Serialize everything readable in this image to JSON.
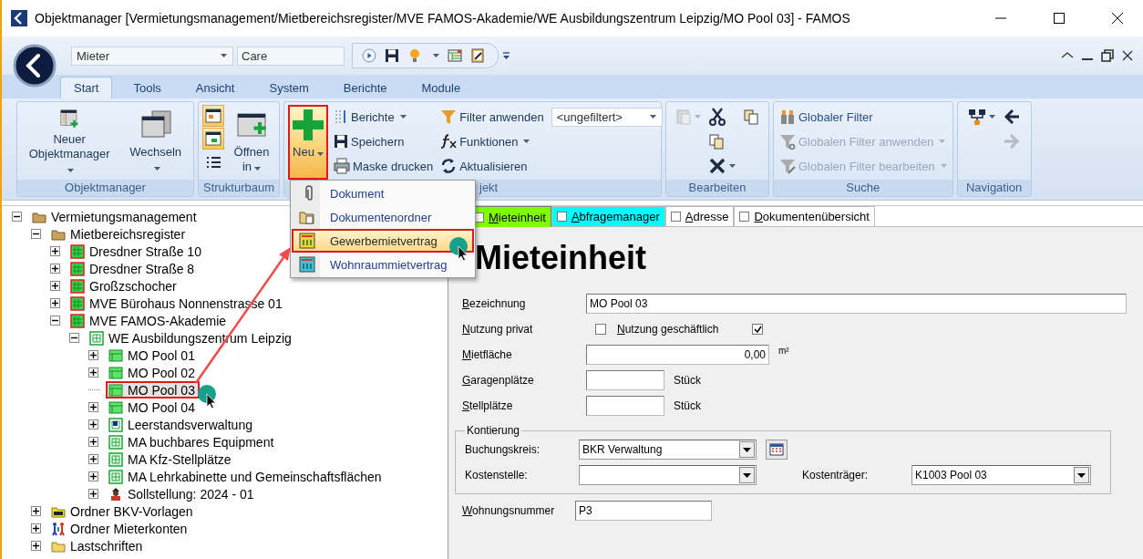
{
  "window": {
    "title": "Objektmanager [Vermietungsmanagement/Mietbereichsregister/MVE FAMOS-Akademie/WE Ausbildungszentrum Leipzig/MO Pool 03] - FAMOS"
  },
  "quick_access": {
    "object_type": "Mieter",
    "search_value": "Care"
  },
  "ribbon_tabs": [
    {
      "label": "Start",
      "selected": true
    },
    {
      "label": "Tools",
      "selected": false
    },
    {
      "label": "Ansicht",
      "selected": false
    },
    {
      "label": "System",
      "selected": false
    },
    {
      "label": "Berichte",
      "selected": false
    },
    {
      "label": "Module",
      "selected": false
    }
  ],
  "ribbon_groups": [
    {
      "title": "Objektmanager",
      "columns": [
        [
          {
            "kind": "large",
            "label": "Neuer Objektmanager",
            "dropdown": true
          }
        ],
        [
          {
            "kind": "large",
            "label": "Wechseln",
            "dropdown": true
          }
        ]
      ]
    },
    {
      "title": "Strukturbaum",
      "columns": [
        [
          {
            "kind": "toggle",
            "on": true
          },
          {
            "kind": "toggle",
            "on": true
          },
          {
            "kind": "icon",
            "disabled": false
          }
        ],
        [
          {
            "kind": "large",
            "label": "Öffnen in",
            "dropdown": true
          }
        ]
      ]
    },
    {
      "title": "jekt",
      "columns": [
        [
          {
            "kind": "large",
            "label": "Neu",
            "dropdown": true,
            "pressed": true,
            "callout": true
          }
        ],
        [
          {
            "kind": "small",
            "label": "Berichte",
            "dropdown": true
          },
          {
            "kind": "small",
            "label": "Speichern"
          },
          {
            "kind": "small",
            "label": "Maske drucken"
          }
        ],
        [
          {
            "kind": "filter",
            "label": "Filter anwenden",
            "value": "<ungefiltert>"
          },
          {
            "kind": "small",
            "label": "Funktionen",
            "dropdown": true
          },
          {
            "kind": "small",
            "label": "Aktualisieren"
          }
        ]
      ]
    },
    {
      "title": "Bearbeiten",
      "columns": [
        [
          {
            "kind": "icon",
            "dropdown": true,
            "disabled": true
          }
        ],
        [
          {
            "kind": "icon",
            "disabled": false
          },
          {
            "kind": "icon",
            "disabled": false
          },
          {
            "kind": "icon",
            "dropdown": true,
            "disabled": false
          }
        ],
        [
          {
            "kind": "icon",
            "disabled": false
          }
        ]
      ]
    },
    {
      "title": "Suche",
      "columns": [
        [
          {
            "kind": "small",
            "label": "Globaler Filter",
            "disabled": false
          },
          {
            "kind": "small",
            "label": "Globalen Filter anwenden",
            "dropdown": true,
            "disabled": true
          },
          {
            "kind": "small",
            "label": "Globalen Filter bearbeiten",
            "dropdown": true,
            "disabled": true
          }
        ]
      ]
    },
    {
      "title": "Navigation",
      "columns": [
        [
          {
            "kind": "icon",
            "dropdown": true,
            "disabled": false
          }
        ],
        [
          {
            "kind": "icon",
            "disabled": false
          },
          {
            "kind": "icon",
            "disabled": true
          }
        ]
      ]
    }
  ],
  "new_menu": {
    "items": [
      {
        "label": "Dokument",
        "selected": false
      },
      {
        "label": "Dokumentenordner",
        "selected": false
      },
      {
        "label": "Gewerbemietvertrag",
        "selected": true,
        "callout": true,
        "cursor": true
      },
      {
        "label": "Wohnraummietvertrag",
        "selected": false
      }
    ]
  },
  "tree": [
    {
      "label": "Vermietungsmanagement",
      "kind": "folder",
      "expanded": true,
      "selected": false,
      "children": [
        {
          "label": "Mietbereichsregister",
          "kind": "folder",
          "expanded": true,
          "selected": false,
          "children": [
            {
              "label": "Dresdner Straße 10",
              "kind": "building",
              "has_children": true,
              "selected": false
            },
            {
              "label": "Dresdner Straße 8",
              "kind": "building",
              "has_children": true,
              "selected": false
            },
            {
              "label": "Großzschocher",
              "kind": "building",
              "has_children": true,
              "selected": false
            },
            {
              "label": "MVE Bürohaus Nonnenstrasse 01",
              "kind": "building",
              "has_children": true,
              "selected": false
            },
            {
              "label": "MVE FAMOS-Akademie",
              "kind": "building",
              "expanded": true,
              "selected": false,
              "children": [
                {
                  "label": "WE Ausbildungszentrum Leipzig",
                  "kind": "estate",
                  "expanded": true,
                  "selected": false,
                  "children": [
                    {
                      "label": "MO Pool 01",
                      "kind": "room",
                      "has_children": true,
                      "selected": false
                    },
                    {
                      "label": "MO Pool 02",
                      "kind": "room",
                      "has_children": true,
                      "selected": false
                    },
                    {
                      "label": "MO Pool 03",
                      "kind": "room",
                      "has_children": false,
                      "selected": true,
                      "callout": true,
                      "cursor": true
                    },
                    {
                      "label": "MO Pool 04",
                      "kind": "room",
                      "has_children": true,
                      "selected": false
                    },
                    {
                      "label": "Leerstandsverwaltung",
                      "kind": "vacancy",
                      "has_children": true,
                      "selected": false
                    },
                    {
                      "label": "MA buchbares Equipment",
                      "kind": "area",
                      "has_children": true,
                      "selected": false
                    },
                    {
                      "label": "MA Kfz-Stellplätze",
                      "kind": "area",
                      "has_children": true,
                      "selected": false
                    },
                    {
                      "label": "MA Lehrkabinette und Gemeinschaftsflächen",
                      "kind": "area",
                      "has_children": true,
                      "selected": false
                    },
                    {
                      "label": "Sollstellung: 2024 - 01",
                      "kind": "billing",
                      "has_children": true,
                      "selected": false
                    }
                  ]
                }
              ]
            }
          ]
        },
        {
          "label": "Ordner BKV-Vorlagen",
          "kind": "bkv",
          "has_children": true,
          "selected": false
        },
        {
          "label": "Ordner Mieterkonten",
          "kind": "people",
          "has_children": true,
          "selected": false
        },
        {
          "label": "Lastschriften",
          "kind": "plainfolder",
          "has_children": true,
          "selected": false
        }
      ]
    }
  ],
  "detail_tabs": [
    {
      "label": "Mieteinheit",
      "selected": true,
      "checked": false,
      "color": "#80ff00"
    },
    {
      "label": "Abfragemanager",
      "selected": false,
      "checked": false,
      "color": "#00ffff"
    },
    {
      "label": "Adresse",
      "selected": false,
      "checked": false,
      "color": "#ffffff"
    },
    {
      "label": "Dokumentenübersicht",
      "selected": false,
      "checked": false,
      "color": "#ffffff"
    }
  ],
  "form": {
    "heading": "Mieteinheit",
    "bezeichnung": {
      "label": "Bezeichnung",
      "value": "MO Pool 03"
    },
    "nutzung": [
      {
        "label": "Nutzung privat",
        "checked": false
      },
      {
        "label": "Nutzung geschäftlich",
        "checked": true
      }
    ],
    "mietflaeche": {
      "label": "Mietfläche",
      "value": "0,00",
      "unit": "m²"
    },
    "garagenplaetze": {
      "label": "Garagenplätze",
      "unit": "Stück"
    },
    "stellplaetze": {
      "label": "Stellplätze",
      "unit": "Stück"
    },
    "kontierung": {
      "title": "Kontierung",
      "buchungskreis": {
        "label": "Buchungskreis:",
        "value": "BKR Verwaltung"
      },
      "kostenstelle": {
        "label": "Kostenstelle:"
      },
      "kostentraeger": {
        "label": "Kostenträger:",
        "value": "K1003 Pool 03"
      }
    },
    "wohnungsnummer": {
      "label": "Wohnungsnummer",
      "value": "P3"
    }
  }
}
